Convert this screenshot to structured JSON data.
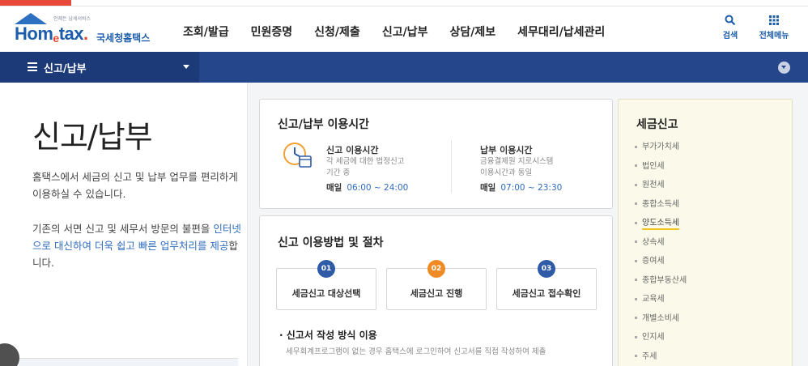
{
  "colors": {
    "brand_blue": "#1b5cab",
    "nav_blue": "#26468c",
    "accent_orange": "#f08a24",
    "step_blue": "#2e5aa8",
    "link_blue": "#2f6cbd",
    "highlight_yellow": "#f0c419"
  },
  "logo": {
    "brand": "Hom",
    "brand_e": "e",
    "brand_tail": "tax",
    "brand_dot": ".",
    "kor": "국세청홈택스",
    "tagline": "언제든 납세서비스"
  },
  "gnb": [
    "조회/발급",
    "민원증명",
    "신청/제출",
    "신고/납부",
    "상담/제보",
    "세무대리/납세관리"
  ],
  "header_actions": {
    "search_label": "검색",
    "search_icon": "search-icon",
    "menu_label": "전체메뉴",
    "menu_icon": "grid-icon"
  },
  "navbar": {
    "title": "신고/납부"
  },
  "page": {
    "title": "신고/납부",
    "desc1": "홈택스에서 세금의 신고 및 납부 업무를 편리하게 이용하실 수 있습니다.",
    "desc2_a": "기존의 서면 신고 및 세무서 방문의 불편을 ",
    "desc2_hl": "인터넷으로 대신하여 더욱 쉽고 빠른 업무처리를 제공",
    "desc2_b": "합니다."
  },
  "hours_card": {
    "title": "신고/납부 이용시간",
    "filing": {
      "name": "신고 이용시간",
      "sub1": "각 세금에 대한 법정신고",
      "sub2": "기간 중",
      "day": "매일",
      "time": "06:00 ~ 24:00"
    },
    "payment": {
      "name": "납부 이용시간",
      "sub1": "금융결제원 지로시스템",
      "sub2": "이용시간과 동일",
      "day": "매일",
      "time": "07:00 ~ 23:30"
    }
  },
  "procedure_card": {
    "title": "신고 이용방법 및 절차",
    "steps": [
      {
        "num": "01",
        "label": "세금신고 대상선택",
        "color": "#2e5aa8"
      },
      {
        "num": "02",
        "label": "세금신고 진행",
        "color": "#f08a24"
      },
      {
        "num": "03",
        "label": "세금신고 접수확인",
        "color": "#2e5aa8"
      }
    ],
    "method_title": "신고서 작성 방식 이용",
    "method_desc": "세무회계프로그램이 없는 경우 홈택스에 로그인하여 신고서를 직접 작성하여 제출"
  },
  "tax_menu": {
    "title": "세금신고",
    "items": [
      "부가가치세",
      "법인세",
      "원천세",
      "종합소득세",
      "양도소득세",
      "상속세",
      "증여세",
      "종합부동산세",
      "교육세",
      "개별소비세",
      "인지세",
      "주세"
    ],
    "active_index": 4
  }
}
